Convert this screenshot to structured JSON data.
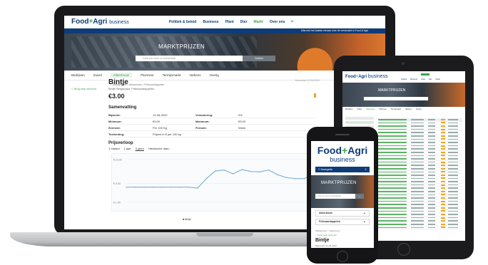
{
  "brand": {
    "word1": "Food",
    "plus": "+",
    "word2": "Agri",
    "suffix": "business",
    "colors": {
      "navy": "#0d3c78",
      "green": "#3ea64a",
      "orange": "#f2a21f"
    }
  },
  "laptop": {
    "nav": [
      "Politiek & beleid",
      "Business",
      "Plant",
      "Dier",
      "Markt",
      "Over ons"
    ],
    "nav_active": "Markt",
    "search_icon": "search-icon",
    "notice": "Mist niet het laatste nieuws over de versmarkt in Food & Agri",
    "hero": {
      "title": "MARKTPRIJZEN",
      "search_placeholder": "Zoek een soort of marktplaats",
      "search_button": "Zoeken"
    },
    "tabs": [
      "Bedrijven",
      "Zuivel",
      "Akkerbouw",
      "Pluimvee",
      "Termijnmarkt",
      "Varkens",
      "Overig"
    ],
    "active_tab": "Akkerbouw",
    "breadcrumb": "Marktprijzen > Akkerbouw > Fritesaardappelen",
    "back_link": "< Terug naar overzicht",
    "product": {
      "title": "Bintje",
      "subtitle": "Bintjé Belgaplant, Fritesaardappelen",
      "price": "€3.00",
      "right_note": "Bouwvlak 12-06-2020"
    },
    "summary": {
      "heading": "Samenvatting",
      "rows": [
        {
          "k1": "Bijwerkt:",
          "v1": "12-06-2020",
          "k2": "Verandering:",
          "v2": "0%"
        },
        {
          "k1": "Minimum:",
          "v1": "€3.00",
          "k2": "Maximum:",
          "v2": "€3.00"
        },
        {
          "k1": "Eenheid:",
          "v1": "Per 100 Kg",
          "k2": "Periode:",
          "v2": "Week"
        },
        {
          "k1": "Toelichting:",
          "v1": "Prijzen in € per 100 kg",
          "k2": "",
          "v2": ""
        }
      ]
    },
    "history": {
      "heading": "Prijsverloop",
      "ranges": [
        "1 maand",
        "1 jaar",
        "3 jaren",
        "Historische data..."
      ],
      "selected_range": "3 jaren",
      "legend": "Bintje"
    }
  },
  "chart_data": {
    "type": "line",
    "series": [
      {
        "name": "Bintje",
        "values": [
          4.2,
          4.2,
          4.2,
          4.2,
          4.2,
          4.2,
          4.2,
          4.2,
          4.0,
          6.0,
          7.6,
          7.8,
          7.0,
          7.9,
          7.5,
          7.4,
          7.8,
          6.8,
          6.2,
          6.0,
          6.0,
          6.8
        ]
      }
    ],
    "y_ticks": [
      "€ 10.00",
      "€ 5.00",
      "€ 1.00"
    ],
    "ylim": [
      1,
      10
    ],
    "color": "#7fb3d8"
  },
  "tablet": {
    "nav": [
      "Politiek",
      "Business",
      "Plant",
      "Dier",
      "Markt"
    ],
    "hero_title": "MARKTPRIJZEN",
    "tabs": [
      "Bedrijven",
      "Zuivel",
      "Akkerbouw",
      "Pluimvee",
      "Termijnmarkt",
      "Varkens",
      "Overig"
    ]
  },
  "phone": {
    "logo_word1": "Food",
    "logo_plus": "+",
    "logo_word2": "Agri",
    "logo_suffix": "business",
    "nav_label": "≡ Navigatie",
    "hero_title": "MARKTPRIJZEN",
    "search_placeholder": "Zoek een soort of marktplaats",
    "search_button": "›",
    "select1": "Akkerbouw",
    "select2": "Fritesaardappelen",
    "breadcrumb": "Marktprijzen > Akkerbouw",
    "back_link": "< Terug naar overzicht",
    "title": "Bintje",
    "subtitle": "Bijgewerkt 12-06-2020"
  }
}
